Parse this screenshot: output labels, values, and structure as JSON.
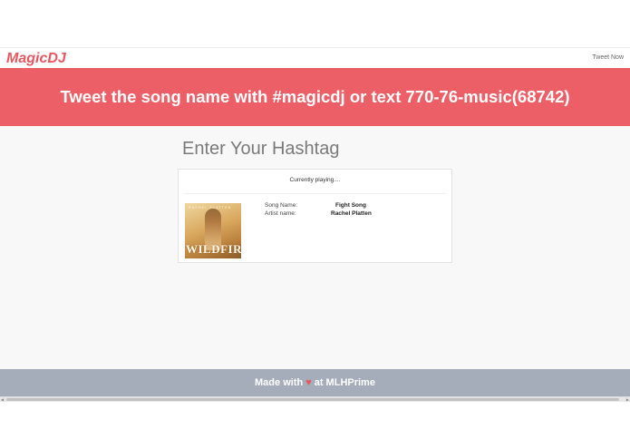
{
  "navbar": {
    "brand": "MagicDJ",
    "tweet_link": "Tweet Now"
  },
  "banner": {
    "text": "Tweet the song name with #magicdj or text 770-76-music(68742)"
  },
  "main": {
    "heading": "Enter Your Hashtag",
    "player": {
      "status": "Currently playing....",
      "song_label": "Song Name:",
      "song_value": "Fight Song",
      "artist_label": "Artist name:",
      "artist_value": "Rachel Platten",
      "album_art": {
        "top_text": "RACHEL PLATTEN",
        "title_text": "WILDFIRE"
      }
    }
  },
  "footer": {
    "prefix": "Made with",
    "heart": "♥",
    "suffix": "at MLHPrime"
  },
  "colors": {
    "brand": "#e8575f",
    "banner": "#ec5f67",
    "footer": "#a5adbb",
    "background": "#f8f8f8"
  },
  "icons": {
    "heart": "heart-icon",
    "scroll_left": "scroll-left-arrow-icon",
    "scroll_right": "scroll-right-arrow-icon"
  }
}
